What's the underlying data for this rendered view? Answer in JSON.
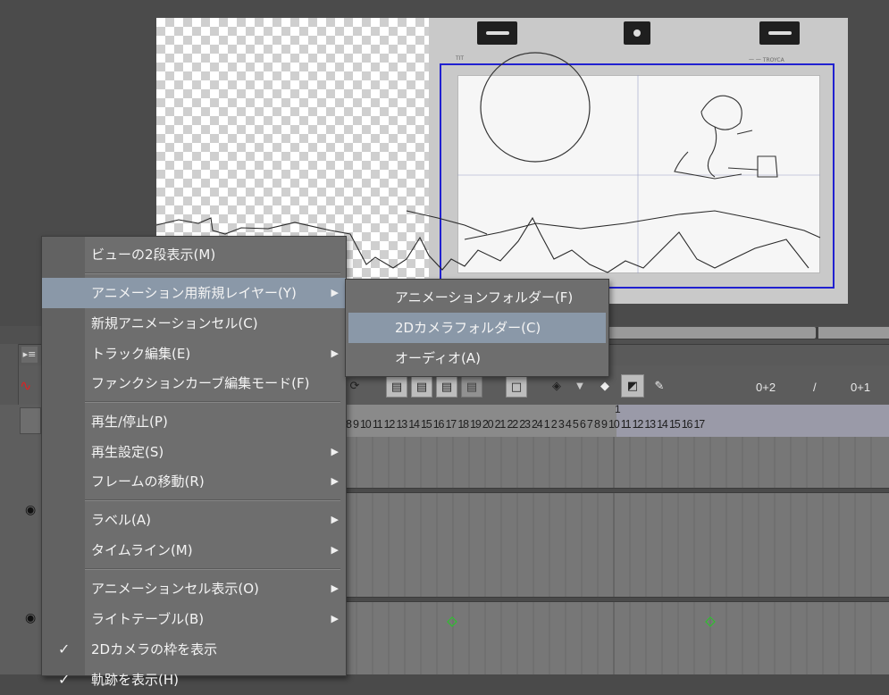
{
  "canvas": {
    "header_text_left": "TIT",
    "header_text_right": "一 一  TROYCA"
  },
  "timeline": {
    "scrollbar_grip": "III",
    "readout_current": "0+2",
    "readout_sep": "/",
    "readout_total": "0+1",
    "frame_marker": "1",
    "frame_numbers": "8  9 10 11 12 13 14 15 16 17 18 19 20 21 22 23 24 1  2  3  4  5  6  7  8  9 10 11 12 13 14 15 16 17"
  },
  "menu": {
    "items": [
      {
        "label": "ビューの2段表示(M)"
      },
      {
        "label": "アニメーション用新規レイヤー(Y)"
      },
      {
        "label": "新規アニメーションセル(C)"
      },
      {
        "label": "トラック編集(E)"
      },
      {
        "label": "ファンクションカーブ編集モード(F)"
      },
      {
        "label": "再生/停止(P)"
      },
      {
        "label": "再生設定(S)"
      },
      {
        "label": "フレームの移動(R)"
      },
      {
        "label": "ラベル(A)"
      },
      {
        "label": "タイムライン(M)"
      },
      {
        "label": "アニメーションセル表示(O)"
      },
      {
        "label": "ライトテーブル(B)"
      },
      {
        "label": "2Dカメラの枠を表示"
      },
      {
        "label": "軌跡を表示(H)"
      }
    ],
    "check_mark": "✓"
  },
  "submenu": {
    "items": [
      {
        "label": "アニメーションフォルダー(F)"
      },
      {
        "label": "2Dカメラフォルダー(C)"
      },
      {
        "label": "オーディオ(A)"
      }
    ]
  },
  "colors": {
    "camera_frame": "#2020d0",
    "menu_bg": "#6e6e6e",
    "menu_highlight": "#8a98a8",
    "keyframe": "#2ec02e"
  }
}
